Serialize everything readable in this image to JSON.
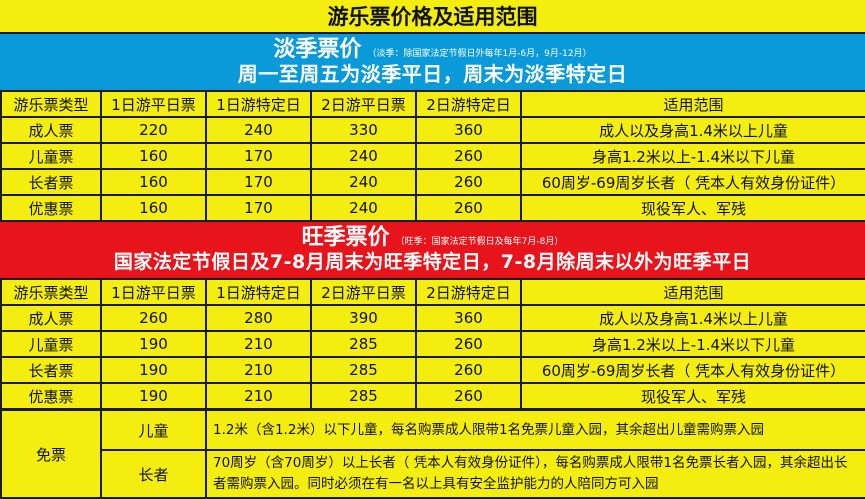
{
  "title": "游乐票价格及适用范围",
  "low_season": {
    "name": "淡季票价",
    "note": "（淡季：除国家法定节假日外每年1月-6月，9月-12月）",
    "desc": "周一至周五为淡季平日，周末为淡季特定日"
  },
  "high_season": {
    "name": "旺季票价",
    "note": "（旺季：国家法定节假日及每年7月-8月）",
    "desc": "国家法定节假日及7-8月周末为旺季特定日，7-8月除周末以外为旺季平日"
  },
  "headers": [
    "游乐票类型",
    "1日游平日票",
    "1日游特定日",
    "2日游平日票",
    "2日游特定日",
    "适用范围"
  ],
  "low_rows": [
    [
      "成人票",
      "220",
      "240",
      "330",
      "360",
      "成人以及身高1.4米以上儿童"
    ],
    [
      "儿童票",
      "160",
      "170",
      "240",
      "260",
      "身高1.2米以上-1.4米以下儿童"
    ],
    [
      "长者票",
      "160",
      "170",
      "240",
      "260",
      "60周岁-69周岁长者（ 凭本人有效身份证件）"
    ],
    [
      "优惠票",
      "160",
      "170",
      "240",
      "260",
      "现役军人、军残"
    ]
  ],
  "high_rows": [
    [
      "成人票",
      "260",
      "280",
      "390",
      "360",
      "成人以及身高1.4米以上儿童"
    ],
    [
      "儿童票",
      "190",
      "210",
      "285",
      "260",
      "身高1.2米以上-1.4米以下儿童"
    ],
    [
      "长者票",
      "190",
      "210",
      "285",
      "260",
      "60周岁-69周岁长者（ 凭本人有效身份证件）"
    ],
    [
      "优惠票",
      "190",
      "210",
      "285",
      "260",
      "现役军人、军残"
    ]
  ],
  "free": {
    "label": "免票",
    "child_label": "儿童",
    "child_text": "1.2米（含1.2米）以下儿童，每名购票成人限带1名免票儿童入园，其余超出儿童需购票入园",
    "senior_label": "长者",
    "senior_text": "70周岁（含70周岁）以上长者（ 凭本人有效身份证件），每名购票成人限带1名免票长者入园，其余超出长者需购票入园。同时必须在有一名以上具有安全监护能力的人陪同方可入园"
  },
  "colors": {
    "background": "#f3ed10",
    "low_band": "#0a9ad9",
    "high_band": "#e8141b"
  }
}
